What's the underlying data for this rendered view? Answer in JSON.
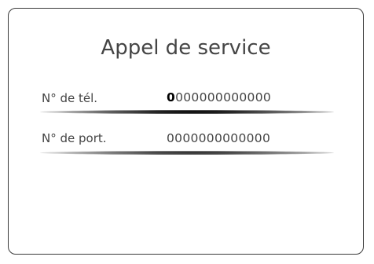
{
  "screen": {
    "title": "Appel de service"
  },
  "fields": [
    {
      "label": "N° de tél.",
      "value_first": "0",
      "value_rest": "000000000000"
    },
    {
      "label": "N° de port.",
      "value": "0000000000000"
    }
  ]
}
